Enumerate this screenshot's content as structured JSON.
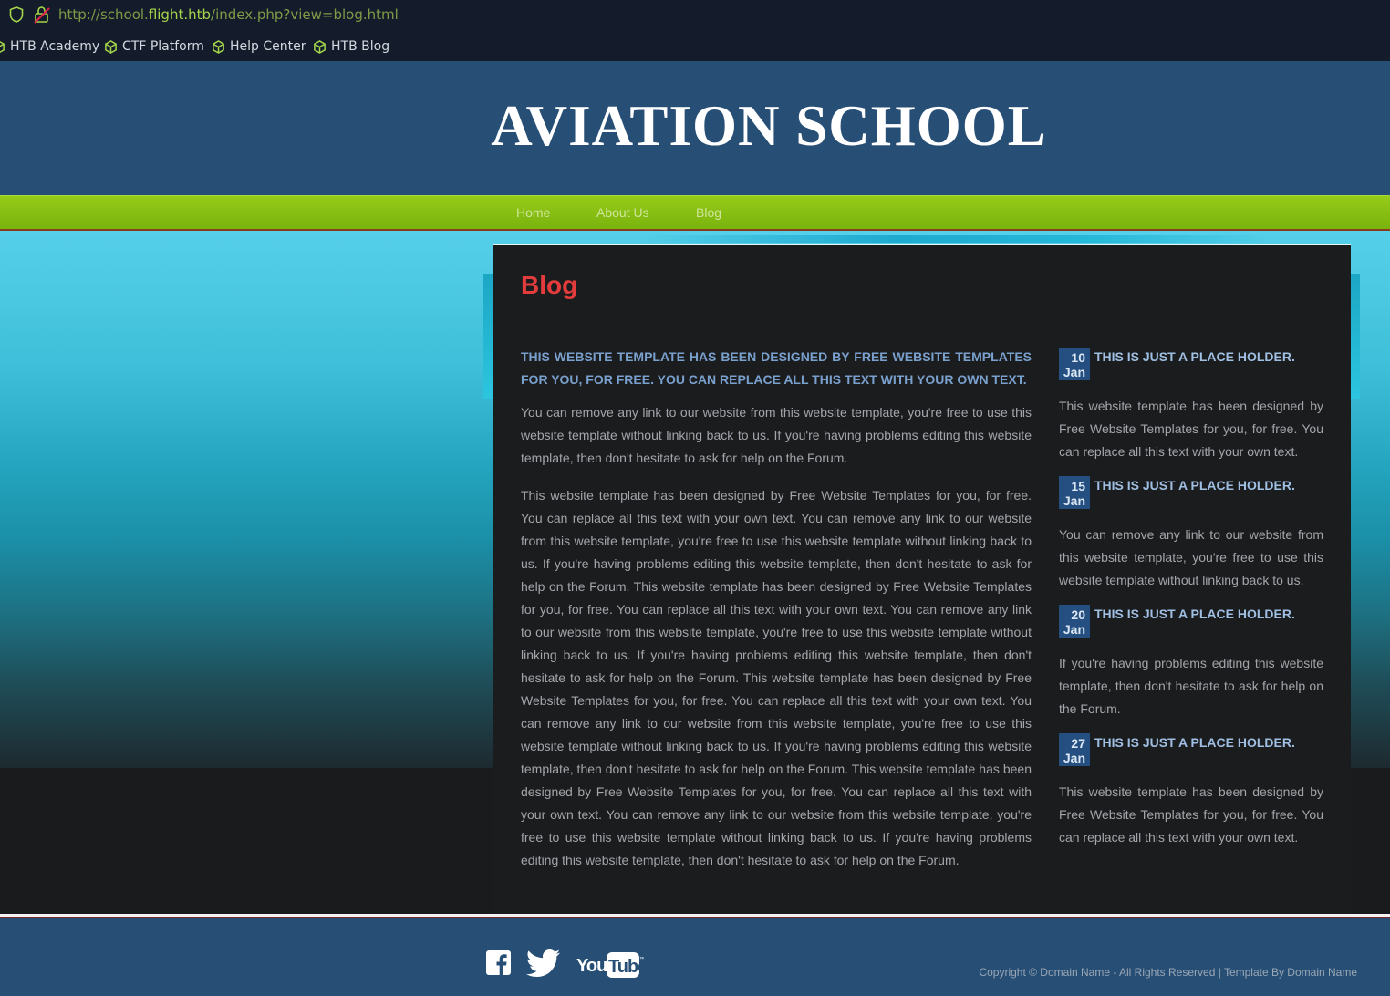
{
  "browser": {
    "url_prefix": "http://school.",
    "url_host": "flight.htb",
    "url_suffix": "/index.php?view=blog.html",
    "bookmarks": [
      "HTB Academy",
      "CTF Platform",
      "Help Center",
      "HTB Blog"
    ],
    "accent_color": "#a4d54a"
  },
  "site": {
    "title": "AVIATION SCHOOL",
    "nav": [
      "Home",
      "About Us",
      "Blog"
    ]
  },
  "page": {
    "heading": "Blog",
    "lead": "THIS WEBSITE TEMPLATE HAS BEEN DESIGNED BY FREE WEBSITE TEMPLATES FOR YOU, FOR FREE. YOU CAN REPLACE ALL THIS TEXT WITH YOUR OWN TEXT.",
    "paragraphs": [
      "You can remove any link to our website from this website template, you're free to use this website template without linking back to us. If you're having problems editing this website template, then don't hesitate to ask for help on the Forum.",
      "This website template has been designed by Free Website Templates for you, for free. You can replace all this text with your own text. You can remove any link to our website from this website template, you're free to use this website template without linking back to us. If you're having problems editing this website template, then don't hesitate to ask for help on the Forum. This website template has been designed by Free Website Templates for you, for free. You can replace all this text with your own text. You can remove any link to our website from this website template, you're free to use this website template without linking back to us. If you're having problems editing this website template, then don't hesitate to ask for help on the Forum. This website template has been designed by Free Website Templates for you, for free. You can replace all this text with your own text. You can remove any link to our website from this website template, you're free to use this website template without linking back to us. If you're having problems editing this website template, then don't hesitate to ask for help on the Forum. This website template has been designed by Free Website Templates for you, for free. You can replace all this text with your own text. You can remove any link to our website from this website template, you're free to use this website template without linking back to us. If you're having problems editing this website template, then don't hesitate to ask for help on the Forum."
    ],
    "posts": [
      {
        "day": "10",
        "month": "Jan",
        "title": "THIS IS JUST A PLACE HOLDER.",
        "text": "This website template has been designed by Free Website Templates for you, for free. You can replace all this text with your own text."
      },
      {
        "day": "15",
        "month": "Jan",
        "title": "THIS IS JUST A PLACE HOLDER.",
        "text": "You can remove any link to our website from this website template, you're free to use this website template without linking back to us."
      },
      {
        "day": "20",
        "month": "Jan",
        "title": "THIS IS JUST A PLACE HOLDER.",
        "text": "If you're having problems editing this website template, then don't hesitate to ask for help on the Forum."
      },
      {
        "day": "27",
        "month": "Jan",
        "title": "THIS IS JUST A PLACE HOLDER.",
        "text": "This website template has been designed by Free Website Templates for you, for free. You can replace all this text with your own text."
      }
    ]
  },
  "footer": {
    "social_icons": [
      "facebook-icon",
      "twitter-icon",
      "youtube-icon"
    ],
    "copyright": "Copyright © Domain Name - All Rights Reserved | Template By Domain Name"
  },
  "colors": {
    "header_blue": "#274e75",
    "nav_green": "#8cc114",
    "heading_red": "#e43c3c",
    "lead_blue": "#7aa0ce",
    "panel": "#1b1c1e"
  }
}
